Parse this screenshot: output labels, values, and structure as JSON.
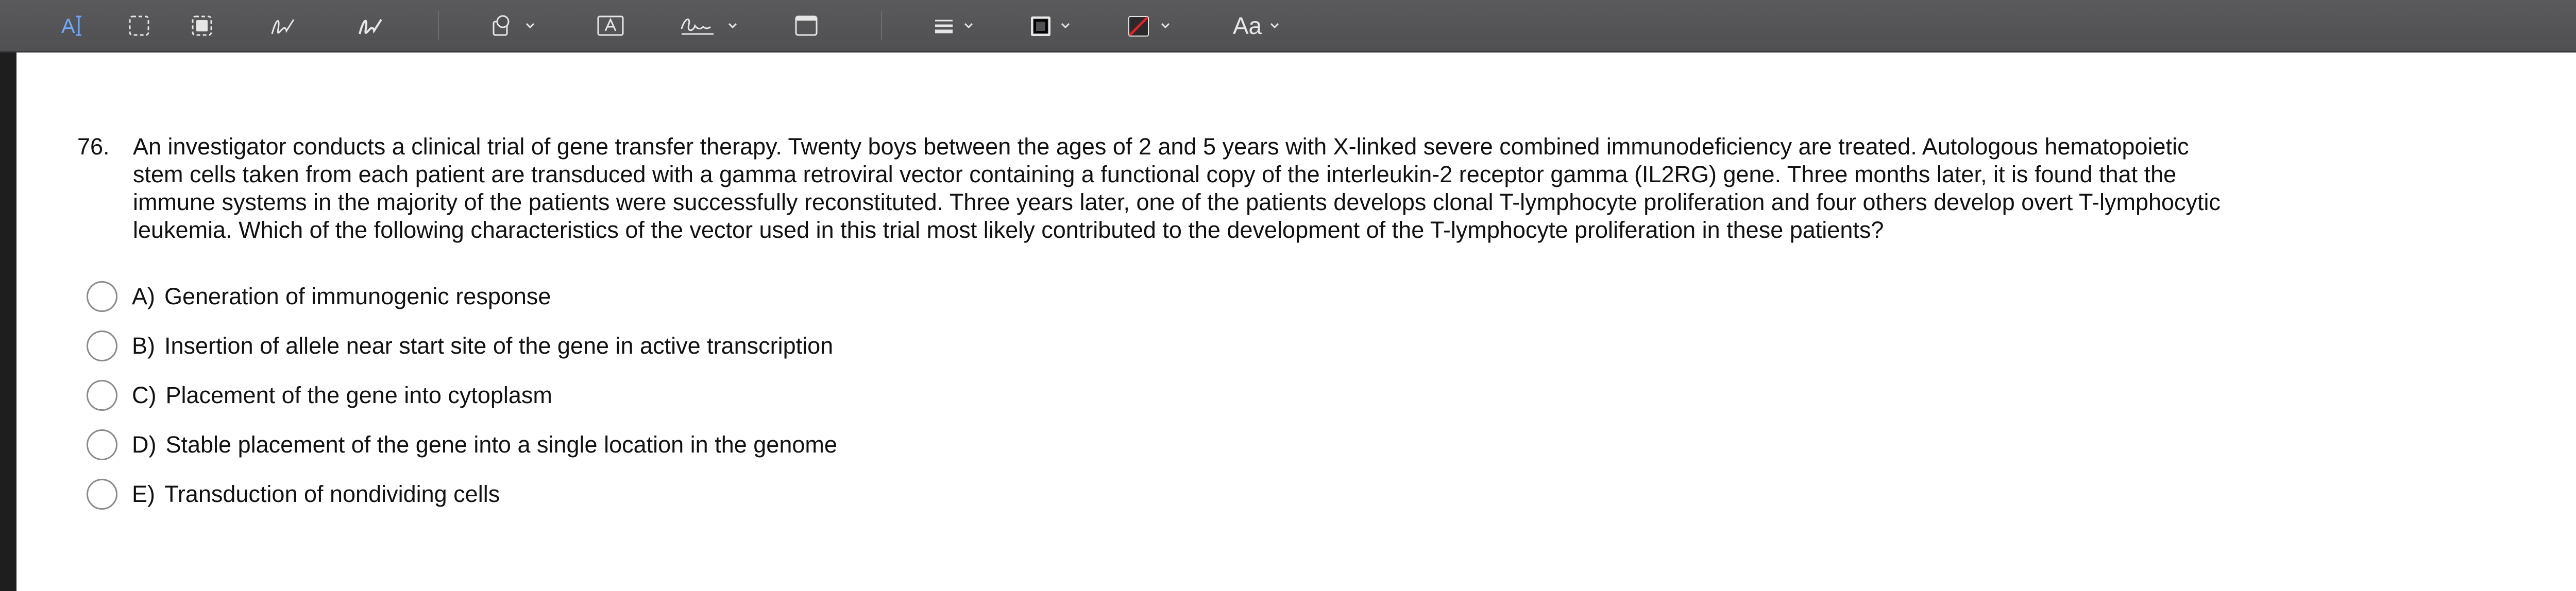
{
  "toolbar": {
    "text_tool_label": "A",
    "font_button_label": "Aa",
    "tools": [
      {
        "name": "text-selection-icon"
      },
      {
        "name": "rectangular-selection-icon"
      },
      {
        "name": "smart-lasso-icon"
      },
      {
        "name": "sketch-icon"
      },
      {
        "name": "draw-icon"
      },
      {
        "name": "shapes-icon"
      },
      {
        "name": "text-box-icon"
      },
      {
        "name": "signature-icon"
      },
      {
        "name": "note-icon"
      },
      {
        "name": "shape-style-icon"
      },
      {
        "name": "border-color-icon"
      },
      {
        "name": "fill-color-icon"
      },
      {
        "name": "text-style-icon"
      }
    ],
    "colors": {
      "border": "#000000",
      "fill_slash": "#e0202a"
    }
  },
  "question": {
    "number": "76.",
    "lines": [
      "An investigator conducts a clinical trial of gene transfer therapy. Twenty boys between the ages of 2 and 5 years with X-linked severe combined immunodeficiency are treated. Autologous hematopoietic",
      "stem cells taken from each patient are transduced with a gamma retroviral vector containing a functional copy of the interleukin-2 receptor gamma (IL2RG) gene. Three months later, it is found that the",
      "immune systems in the majority of the patients were successfully reconstituted. Three years later, one of the patients develops clonal T-lymphocyte proliferation and four others develop overt T-lymphocytic",
      "leukemia. Which of the following characteristics of the vector used in this trial most likely contributed to the development of the T-lymphocyte proliferation in these patients?"
    ]
  },
  "options": [
    {
      "letter": "A)",
      "text": "Generation of immunogenic response"
    },
    {
      "letter": "B)",
      "text": "Insertion of allele near start site of the gene in active transcription"
    },
    {
      "letter": "C)",
      "text": "Placement of the gene into cytoplasm"
    },
    {
      "letter": "D)",
      "text": "Stable placement of the gene into a single location in the genome"
    },
    {
      "letter": "E)",
      "text": "Transduction of nondividing cells"
    }
  ]
}
